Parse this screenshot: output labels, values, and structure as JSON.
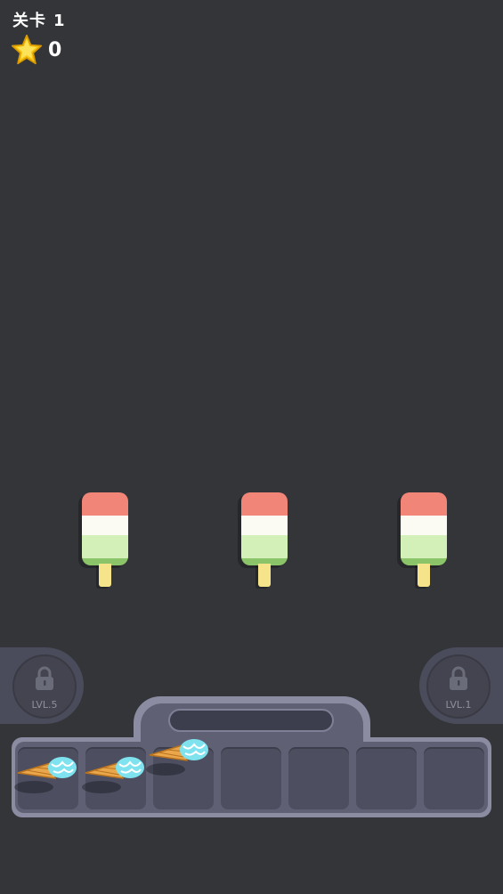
{
  "hud": {
    "level_prefix": "关卡",
    "level_number": "1",
    "star_count": "0"
  },
  "targets": [
    {
      "type": "popsicle",
      "colors": [
        "#f08578",
        "#fbfbf4",
        "#d3f0b8"
      ]
    },
    {
      "type": "popsicle",
      "colors": [
        "#f08578",
        "#fbfbf4",
        "#d3f0b8"
      ]
    },
    {
      "type": "popsicle",
      "colors": [
        "#f08578",
        "#fbfbf4",
        "#d3f0b8"
      ]
    }
  ],
  "locked_slots": {
    "left_label": "LVL.5",
    "right_label": "LVL.1"
  },
  "tray": {
    "slot_count": 7,
    "filled_slots": [
      {
        "slot": 1,
        "item": "ice-cream-cone",
        "scoop_color": "#7fe3ef"
      },
      {
        "slot": 2,
        "item": "ice-cream-cone",
        "scoop_color": "#7fe3ef"
      },
      {
        "slot": 3,
        "item": "ice-cream-cone",
        "scoop_color": "#7fe3ef"
      }
    ]
  },
  "colors": {
    "background": "#333539",
    "tray": "#8b8ca1",
    "slot": "#4d4e60",
    "star": "#f8c613"
  }
}
